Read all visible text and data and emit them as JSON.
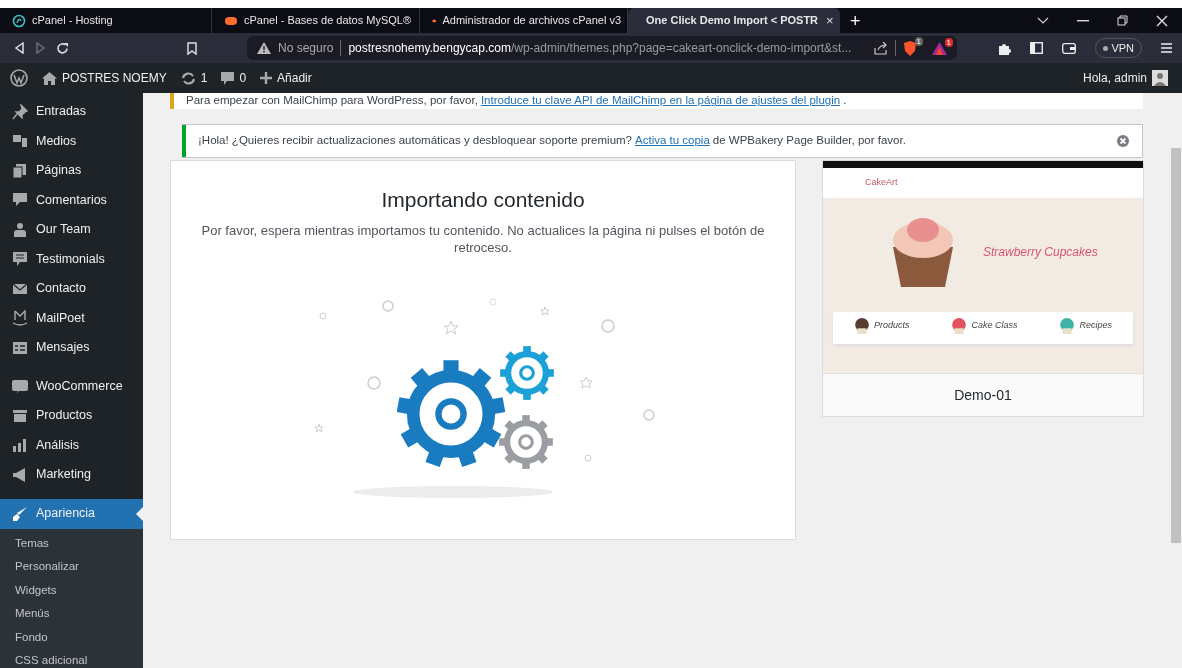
{
  "browser": {
    "tabs": [
      {
        "title": "cPanel - Hosting",
        "kind": "hosting",
        "selected": false
      },
      {
        "title": "cPanel - Bases de datos MySQL®",
        "kind": "cpanel",
        "selected": false
      },
      {
        "title": "Administrador de archivos cPanel v3",
        "kind": "cpanel",
        "selected": false
      },
      {
        "title": "One Click Demo Import < POSTR",
        "kind": "page",
        "selected": true
      }
    ],
    "tab_close": "×",
    "new_tab": "+",
    "address": {
      "security": "No seguro",
      "host": "postresnohemy.bengycap.com",
      "path": "/wp-admin/themes.php?page=cakeart-onclick-demo-import&st..."
    },
    "shield_badge": "1",
    "rewards_badge": "1",
    "vpn": "VPN"
  },
  "admin_bar": {
    "site": "POSTRES NOEMY",
    "updates": "1",
    "comments": "0",
    "add": "Añadir",
    "greeting": "Hola, admin"
  },
  "sidebar": {
    "groups": [
      {
        "items": [
          {
            "label": "Entradas",
            "selected": false
          },
          {
            "label": "Medios",
            "selected": false
          },
          {
            "label": "Páginas",
            "selected": false
          },
          {
            "label": "Comentarios",
            "selected": false
          },
          {
            "label": "Our Team",
            "selected": false
          },
          {
            "label": "Testimonials",
            "selected": false
          },
          {
            "label": "Contacto",
            "selected": false
          },
          {
            "label": "MailPoet",
            "selected": false
          },
          {
            "label": "Mensajes",
            "selected": false
          }
        ]
      },
      {
        "items": [
          {
            "label": "WooCommerce",
            "selected": false
          },
          {
            "label": "Productos",
            "selected": false
          },
          {
            "label": "Análisis",
            "selected": false
          },
          {
            "label": "Marketing",
            "selected": false
          }
        ]
      },
      {
        "items": [
          {
            "label": "Apariencia",
            "selected": true
          }
        ]
      }
    ],
    "submenu": [
      {
        "label": "Temas"
      },
      {
        "label": "Personalizar"
      },
      {
        "label": "Widgets"
      },
      {
        "label": "Menús"
      },
      {
        "label": "Fondo"
      },
      {
        "label": "CSS adicional"
      }
    ]
  },
  "notices": [
    {
      "color": "#dba617",
      "before": "Para empezar con MailChimp para WordPress, por favor, ",
      "link": "Introduce tu clave API de MailChimp en la página de ajustes del plugin",
      "after": ".",
      "dismissible": false
    },
    {
      "color": "#00a32a",
      "before": "¡Hola! ¿Quieres recibir actualizaciones automáticas y desbloquear soporte premium? ",
      "link": "Activa tu copia",
      "after": " de WPBakery Page Builder, por favor.",
      "dismissible": true
    }
  ],
  "import_panel": {
    "title": "Importando contenido",
    "message": "Por favor, espera mientras importamos tu contenido. No actualices la página ni pulses el botón de retroceso."
  },
  "demo": {
    "name": "Demo-01",
    "preview": {
      "logo": "CakeArt",
      "headline": "Strawberry Cupcakes",
      "features": [
        "Products",
        "Cake Class",
        "Recipes"
      ]
    }
  }
}
